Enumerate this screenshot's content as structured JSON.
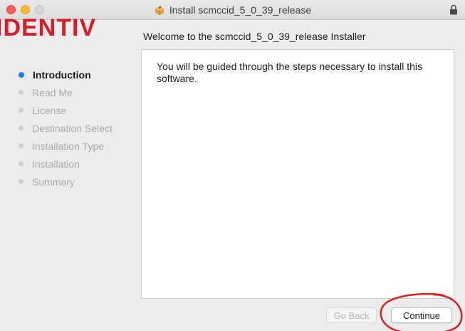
{
  "window": {
    "title": "Install scmccid_5_0_39_release"
  },
  "sidebar": {
    "logo_text": "IDENTIV",
    "steps": [
      {
        "label": "Introduction",
        "state": "active"
      },
      {
        "label": "Read Me",
        "state": "pending"
      },
      {
        "label": "License",
        "state": "pending"
      },
      {
        "label": "Destination Select",
        "state": "pending"
      },
      {
        "label": "Installation Type",
        "state": "pending"
      },
      {
        "label": "Installation",
        "state": "pending"
      },
      {
        "label": "Summary",
        "state": "pending"
      }
    ]
  },
  "main": {
    "heading": "Welcome to the scmccid_5_0_39_release Installer",
    "body": "You will be guided through the steps necessary to install this software."
  },
  "buttons": {
    "back_label": "Go Back",
    "back_enabled": false,
    "continue_label": "Continue"
  },
  "colors": {
    "active_step_dot": "#1e7ff0",
    "logo": "#d91c2a",
    "annotation": "#e11d1d"
  },
  "icons": {
    "title_icon": "package-icon",
    "lock": "lock-icon"
  }
}
